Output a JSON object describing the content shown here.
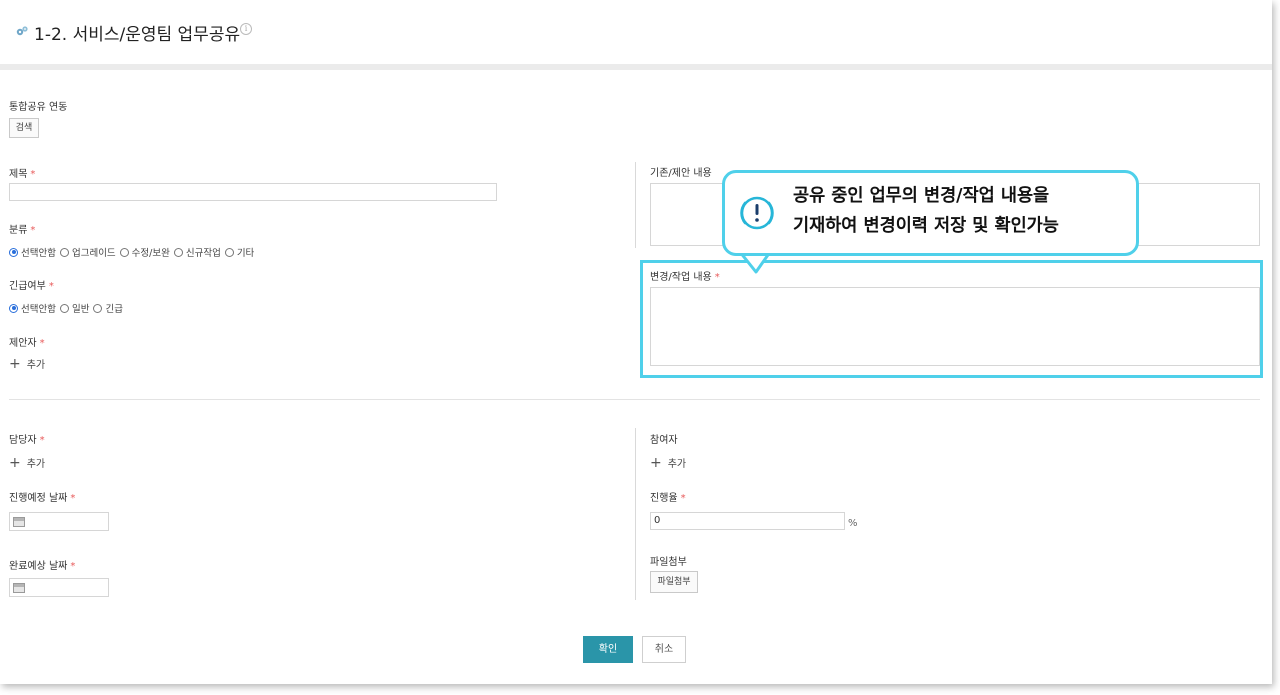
{
  "header": {
    "title": "1-2. 서비스/운영팀 업무공유",
    "title_icon": "gear-icon",
    "info_icon": "info-icon"
  },
  "integration": {
    "label": "통합공유 연동",
    "search_button": "검색"
  },
  "subject": {
    "label": "제목",
    "required_mark": "*",
    "value": ""
  },
  "category": {
    "label": "분류",
    "required_mark": "*",
    "options": [
      "선택안함",
      "업그레이드",
      "수정/보완",
      "신규작업",
      "기타"
    ],
    "selected": "선택안함"
  },
  "urgency": {
    "label": "긴급여부",
    "required_mark": "*",
    "options": [
      "선택안함",
      "일반",
      "긴급"
    ],
    "selected": "선택안함"
  },
  "proposer": {
    "label": "제안자",
    "required_mark": "*",
    "add_label": "추가"
  },
  "existing_content": {
    "label": "기존/제안 내용"
  },
  "change_content": {
    "label": "변경/작업 내용",
    "required_mark": "*"
  },
  "callout": {
    "line1": "공유 중인 업무의 변경/작업 내용을",
    "line2": "기재하여 변경이력 저장 및 확인가능",
    "icon": "exclamation-icon",
    "accent_color": "#4fd0ea"
  },
  "assignee": {
    "label": "담당자",
    "required_mark": "*",
    "add_label": "추가"
  },
  "participant": {
    "label": "참여자",
    "add_label": "추가"
  },
  "planned_date": {
    "label": "진행예정 날짜",
    "required_mark": "*",
    "value": ""
  },
  "progress": {
    "label": "진행율",
    "required_mark": "*",
    "value": "0",
    "unit": "%"
  },
  "due_date": {
    "label": "완료예상 날짜",
    "required_mark": "*",
    "value": ""
  },
  "attachment": {
    "label": "파일첨부",
    "button": "파일첨부"
  },
  "actions": {
    "confirm": "확인",
    "cancel": "취소",
    "confirm_color": "#2a95a9"
  }
}
